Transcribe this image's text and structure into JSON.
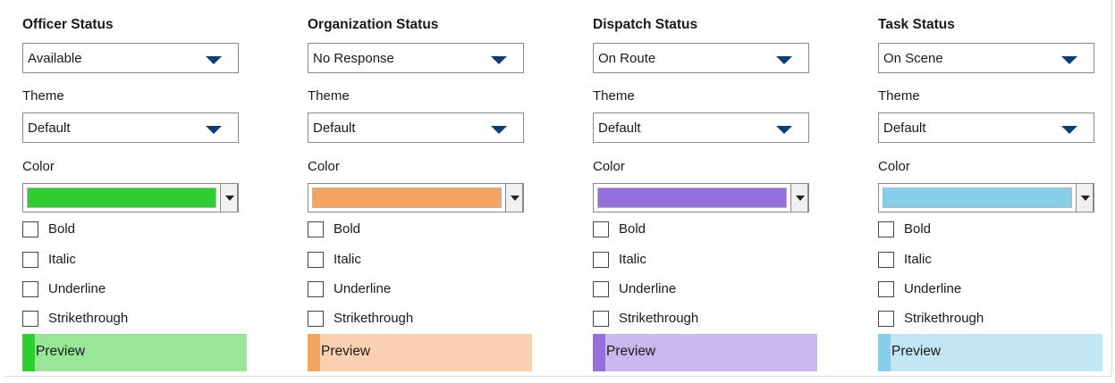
{
  "columns": [
    {
      "title": "Officer Status",
      "status_value": "Available",
      "theme_label": "Theme",
      "theme_value": "Default",
      "color_label": "Color",
      "color_hex": "#32cd32",
      "preview_bg": "#98e698",
      "options": [
        "Bold",
        "Italic",
        "Underline",
        "Strikethrough"
      ],
      "preview_text": "Preview"
    },
    {
      "title": "Organization Status",
      "status_value": "No Response",
      "theme_label": "Theme",
      "theme_value": "Default",
      "color_label": "Color",
      "color_hex": "#f4a460",
      "preview_bg": "#f9d1b0",
      "options": [
        "Bold",
        "Italic",
        "Underline",
        "Strikethrough"
      ],
      "preview_text": "Preview"
    },
    {
      "title": "Dispatch Status",
      "status_value": "On Route",
      "theme_label": "Theme",
      "theme_value": "Default",
      "color_label": "Color",
      "color_hex": "#9370db",
      "preview_bg": "#c9b7ed",
      "options": [
        "Bold",
        "Italic",
        "Underline",
        "Strikethrough"
      ],
      "preview_text": "Preview"
    },
    {
      "title": "Task Status",
      "status_value": "On Scene",
      "theme_label": "Theme",
      "theme_value": "Default",
      "color_label": "Color",
      "color_hex": "#87ceeb",
      "preview_bg": "#c3e6f5",
      "options": [
        "Bold",
        "Italic",
        "Underline",
        "Strikethrough"
      ],
      "preview_text": "Preview"
    }
  ]
}
